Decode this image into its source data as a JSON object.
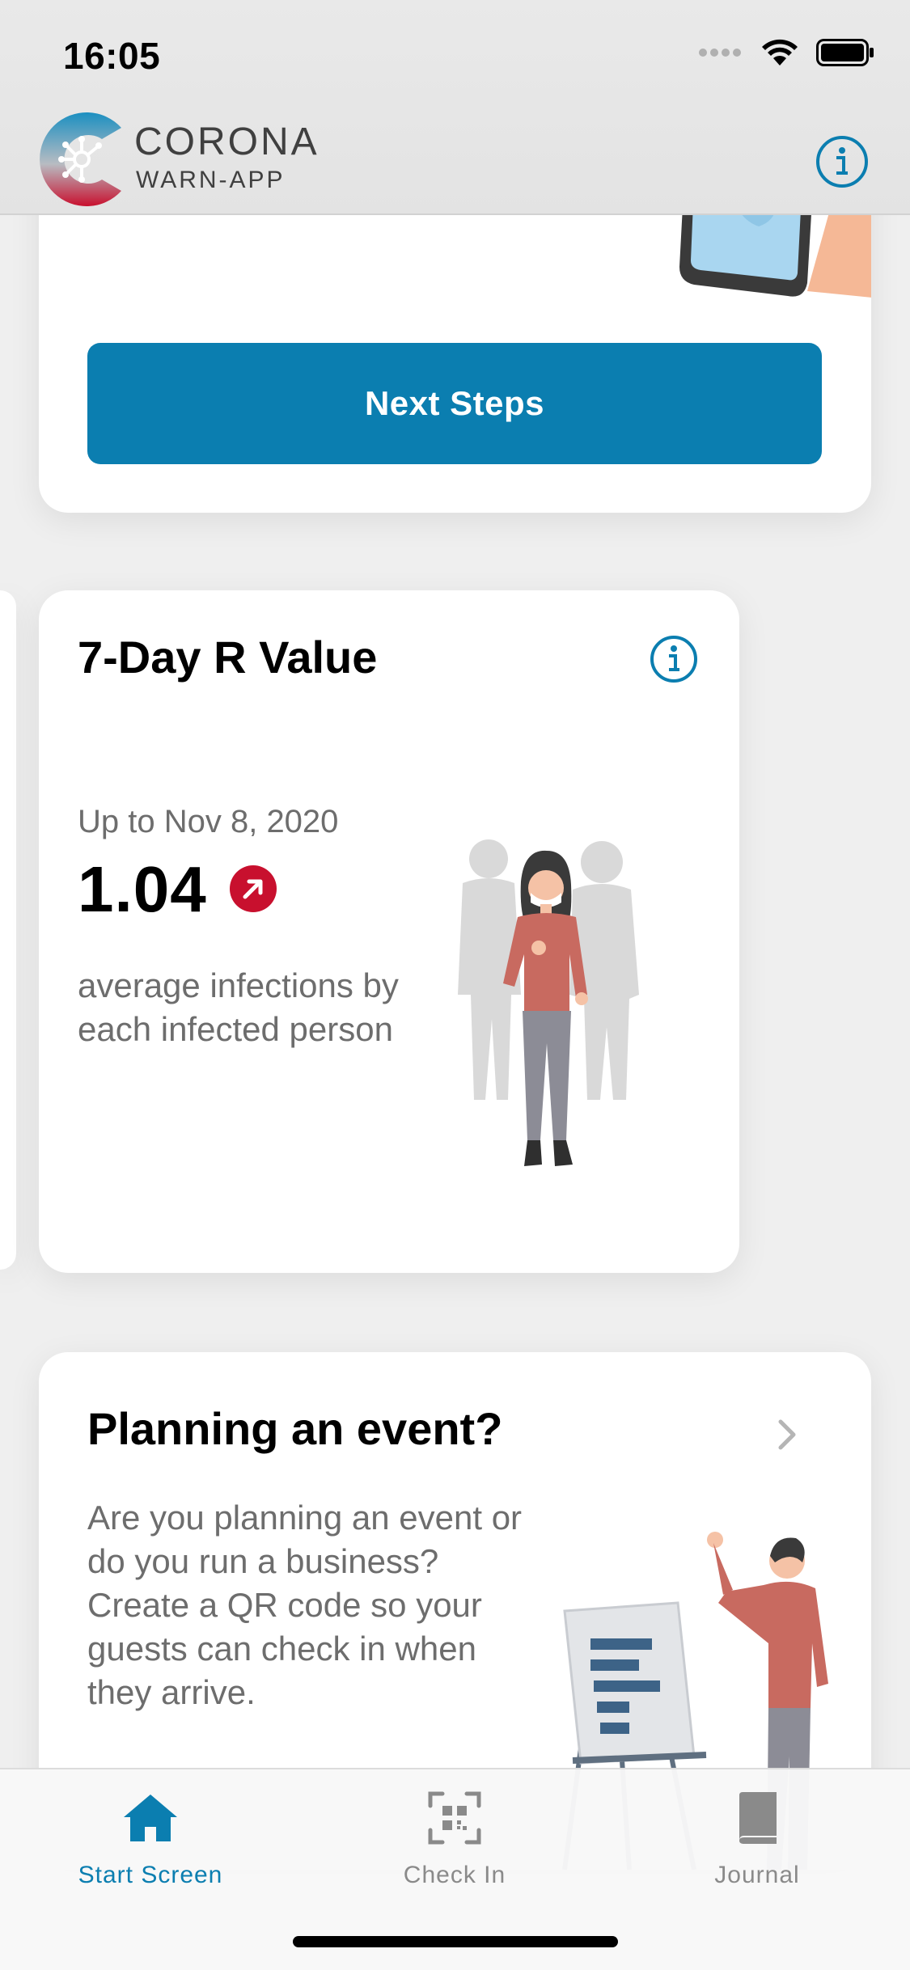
{
  "status_bar": {
    "time": "16:05"
  },
  "header": {
    "brand_line1": "CORONA",
    "brand_line2": "WARN-APP"
  },
  "colors": {
    "accent": "#0b7eb0",
    "alert_red": "#c8102e"
  },
  "result_card": {
    "button_label": "Next Steps"
  },
  "r_value_card": {
    "title": "7-Day R Value",
    "date": "Up to Nov 8, 2020",
    "value": "1.04",
    "trend": "up",
    "description": "average infections by each infected person"
  },
  "event_card": {
    "title": "Planning an event?",
    "description": "Are you planning an event or do you run a business? Create a QR code so your guests can check in when they arrive."
  },
  "tab_bar": {
    "tabs": [
      {
        "label": "Start Screen",
        "icon": "home-icon",
        "active": true
      },
      {
        "label": "Check In",
        "icon": "qr-code-icon",
        "active": false
      },
      {
        "label": "Journal",
        "icon": "book-icon",
        "active": false
      }
    ]
  }
}
